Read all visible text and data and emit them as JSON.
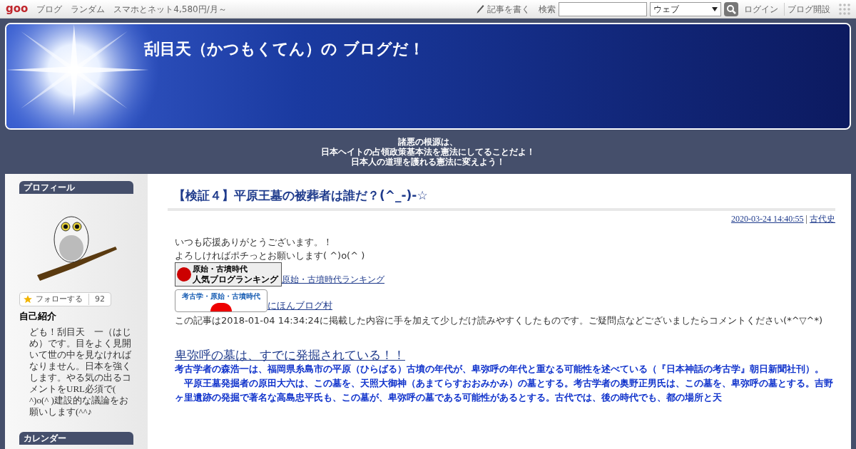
{
  "topbar": {
    "logo": "goo",
    "links": [
      "ブログ",
      "ランダム",
      "スマホとネット4,580円/月～"
    ],
    "write": "記事を書く",
    "search_label": "検索",
    "select": "ウェブ",
    "login": "ログイン",
    "open_blog": "ブログ開設"
  },
  "header": {
    "title": "刮目天（かつもくてん）の ブログだ！"
  },
  "tagline": [
    "諸悪の根源は、",
    "日本ヘイトの占領政策基本法を憲法にしてることだよ！",
    "日本人の道理を護れる憲法に変えよう！"
  ],
  "sidebar": {
    "profile_title": "プロフィール",
    "follow_label": "フォローする",
    "follow_count": "92",
    "intro_title": "自己紹介",
    "intro": "ども！刮目天　一（はじめ）です。目をよく見開いて世の中を見なければなりません。日本を強くします。やる気の出るコメントをURL必須で( ^)o(^ )建設的な議論をお願いします(^^♪",
    "calendar_title": "カレンダー"
  },
  "article": {
    "title": "【検証４】平原王墓の被葬者は誰だ？(^_-)-☆",
    "date": "2020-03-24 14:40:55",
    "separator": "|",
    "category": "古代史",
    "lines": [
      "いつも応援ありがとうございます。！",
      "よろしければポチっとお願いします( ^)o(^ )"
    ],
    "rankings": [
      {
        "kind": "blogranking",
        "badge": "原始・古墳時代",
        "badge_sub": "人気ブログランキング",
        "link": "原始・古墳時代ランキング"
      },
      {
        "kind": "blogmura",
        "badge": "考古学・原始・古墳時代",
        "link": "にほんブログ村"
      }
    ],
    "note": "この記事は2018-01-04 14:34:24に掲載した内容に手を加えて少しだけ読みやすくしたものです。ご疑問点などございましたらコメントください(*^▽^*)",
    "heading": "卑弥呼の墓は、すでに発掘されている！！",
    "paragraphs": [
      "考古学者の森浩一は、福岡県糸島市の平原（ひらばる）古墳の年代が、卑弥呼の年代と重なる可能性を述べている（『日本神話の考古学』朝日新聞社刊）。",
      "　平原王墓発掘者の原田大六は、この墓を、天照大御神（あまてらすおおみかみ）の墓とする。考古学者の奥野正男氏は、この墓を、卑弥呼の墓とする。吉野ヶ里遺跡の発掘で著名な高島忠平氏も、この墓が、卑弥呼の墓である可能性があるとする。古代では、後の時代でも、都の場所と天"
    ]
  }
}
